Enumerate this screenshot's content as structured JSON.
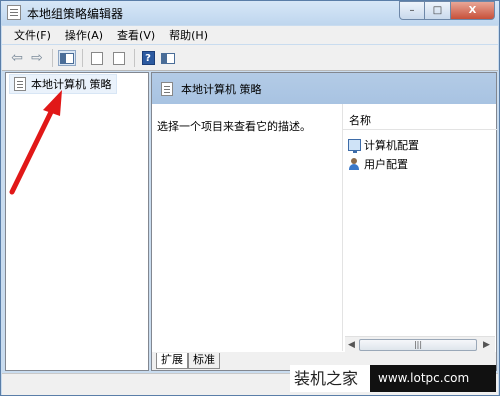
{
  "window": {
    "title": "本地组策略编辑器"
  },
  "caption": {
    "minimize": "–",
    "maximize": "□",
    "close": "X"
  },
  "menubar": {
    "items": [
      {
        "label": "文件(F)"
      },
      {
        "label": "操作(A)"
      },
      {
        "label": "查看(V)"
      },
      {
        "label": "帮助(H)"
      }
    ]
  },
  "toolbar": {
    "back": "⇦",
    "forward": "⇨",
    "help": "?"
  },
  "tree": {
    "root_label": "本地计算机 策略"
  },
  "right_pane": {
    "header_title": "本地计算机 策略",
    "description": "选择一个项目来查看它的描述。",
    "column_header": "名称",
    "rows": [
      {
        "label": "计算机配置",
        "icon": "computer-icon"
      },
      {
        "label": "用户配置",
        "icon": "user-icon"
      }
    ],
    "scroll_grip": "|||"
  },
  "tabs": [
    {
      "label": "扩展",
      "active": true
    },
    {
      "label": "标准",
      "active": false
    }
  ],
  "watermark": {
    "text": "装机之家",
    "url": "www.lotpc.com"
  },
  "colors": {
    "annotation": "#e11818",
    "header_bg": "#aec6e4",
    "title_bar": "#c9dcef"
  }
}
